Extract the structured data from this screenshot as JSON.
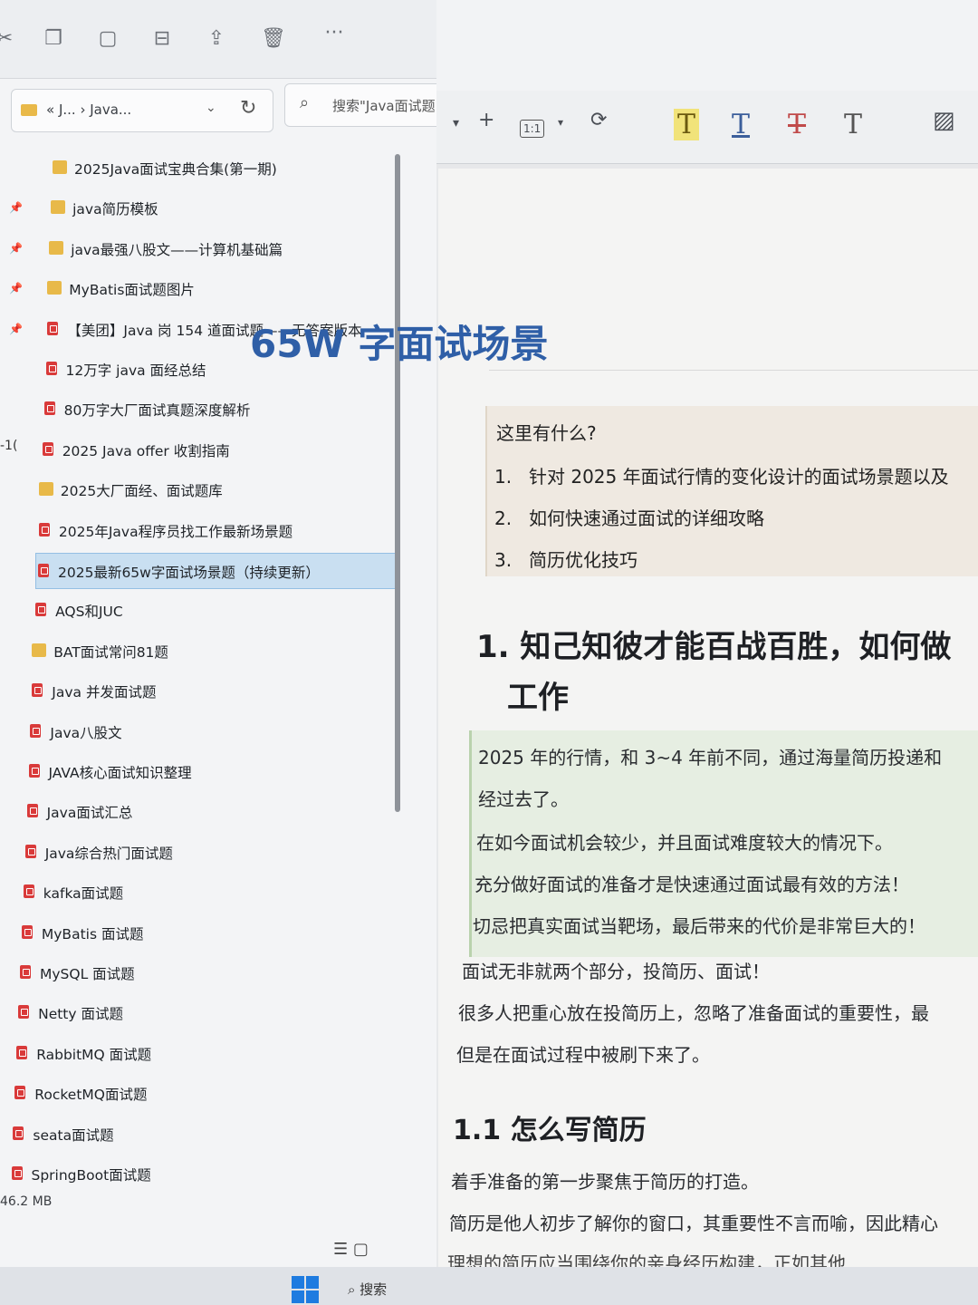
{
  "explorer": {
    "toolbar_icons": [
      "cut-icon",
      "copy-icon",
      "paste-icon",
      "rename-icon",
      "share-icon",
      "delete-icon",
      "more-icon"
    ],
    "address": {
      "crumbs": "« J... › Java...",
      "chevron": "⌄",
      "refresh": "↻"
    },
    "search_placeholder": "搜索\"Java面试题",
    "edge_fragment": "-1(",
    "files": [
      {
        "name": "2025Java面试宝典合集(第一期)",
        "type": "folder",
        "pinned": false
      },
      {
        "name": "java简历模板",
        "type": "folder",
        "pinned": true
      },
      {
        "name": "java最强八股文——计算机基础篇",
        "type": "folder",
        "pinned": true
      },
      {
        "name": "MyBatis面试题图片",
        "type": "folder",
        "pinned": true
      },
      {
        "name": "【美团】Java 岗 154 道面试题——无答案版本",
        "type": "pdf",
        "pinned": true
      },
      {
        "name": "12万字 java 面经总结",
        "type": "pdf",
        "pinned": false
      },
      {
        "name": "80万字大厂面试真题深度解析",
        "type": "pdf",
        "pinned": false
      },
      {
        "name": "2025 Java offer 收割指南",
        "type": "pdf",
        "pinned": false
      },
      {
        "name": "2025大厂面经、面试题库",
        "type": "folder",
        "pinned": false
      },
      {
        "name": "2025年Java程序员找工作最新场景题",
        "type": "pdf",
        "pinned": false
      },
      {
        "name": "2025最新65w字面试场景题（持续更新）",
        "type": "pdf",
        "pinned": false,
        "selected": true
      },
      {
        "name": "AQS和JUC",
        "type": "pdf",
        "pinned": false
      },
      {
        "name": "BAT面试常问81题",
        "type": "folder",
        "pinned": false
      },
      {
        "name": "Java 并发面试题",
        "type": "pdf",
        "pinned": false
      },
      {
        "name": "Java八股文",
        "type": "pdf",
        "pinned": false
      },
      {
        "name": "JAVA核心面试知识整理",
        "type": "pdf",
        "pinned": false
      },
      {
        "name": "Java面试汇总",
        "type": "pdf",
        "pinned": false
      },
      {
        "name": "Java综合热门面试题",
        "type": "pdf",
        "pinned": false
      },
      {
        "name": "kafka面试题",
        "type": "pdf",
        "pinned": false
      },
      {
        "name": "MyBatis 面试题",
        "type": "pdf",
        "pinned": false
      },
      {
        "name": "MySQL 面试题",
        "type": "pdf",
        "pinned": false
      },
      {
        "name": "Netty 面试题",
        "type": "pdf",
        "pinned": false
      },
      {
        "name": "RabbitMQ 面试题",
        "type": "pdf",
        "pinned": false
      },
      {
        "name": "RocketMQ面试题",
        "type": "pdf",
        "pinned": false
      },
      {
        "name": "seata面试题",
        "type": "pdf",
        "pinned": false
      },
      {
        "name": "SpringBoot面试题",
        "type": "pdf",
        "pinned": false
      }
    ],
    "status_size": "46.2 MB"
  },
  "taskbar": {
    "search_label": "搜索"
  },
  "viewer": {
    "tools": {
      "dropdown": "▾",
      "zoom_in": "+",
      "fit_label": "1:1",
      "rotate": "⟳",
      "text_highlight": "T",
      "text_underline": "T",
      "text_strike": "T",
      "text_plain": "T"
    },
    "doc": {
      "title": "65W 字面试场景",
      "infobox_title": "这里有什么?",
      "infobox_items": [
        {
          "num": "1.",
          "text": "针对 2025 年面试行情的变化设计的面试场景题以及"
        },
        {
          "num": "2.",
          "text": "如何快速通过面试的详细攻略"
        },
        {
          "num": "3.",
          "text": "简历优化技巧"
        }
      ],
      "h1_line1": "1. 知己知彼才能百战百胜，如何做",
      "h1_line2": "工作",
      "green_paragraphs": [
        "2025 年的行情，和 3~4 年前不同，通过海量简历投递和",
        "经过去了。",
        "在如今面试机会较少，并且面试难度较大的情况下。",
        "充分做好面试的准备才是快速通过面试最有效的方法！",
        "切忌把真实面试当靶场，最后带来的代价是非常巨大的！"
      ],
      "paragraphs": [
        "面试无非就两个部分，投简历、面试！",
        "很多人把重心放在投简历上，忽略了准备面试的重要性，最",
        "但是在面试过程中被刷下来了。"
      ],
      "h2": "1.1  怎么写简历",
      "paragraphs2": [
        "着手准备的第一步聚焦于简历的打造。",
        "简历是他人初步了解你的窗口，其重要性不言而喻，因此精心",
        "理想的简历应当围绕你的亲身经历构建，正如其他..."
      ]
    }
  }
}
